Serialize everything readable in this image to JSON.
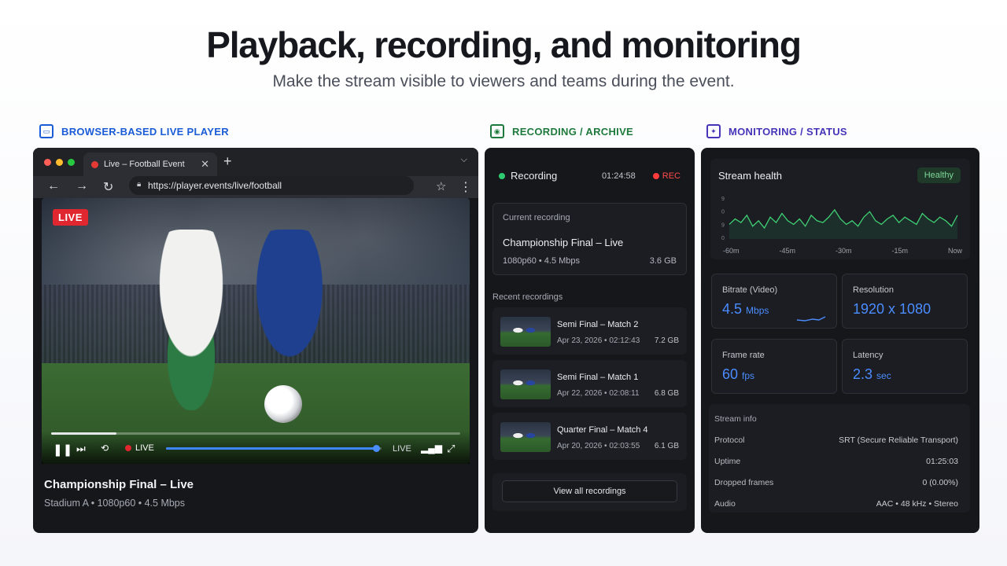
{
  "hero": {
    "title": "Playback, recording, and monitoring",
    "subtitle": "Make the stream visible to viewers and teams during the event."
  },
  "sections": {
    "player": "BROWSER-BASED LIVE PLAYER",
    "recording": "RECORDING / ARCHIVE",
    "monitoring": "MONITORING / STATUS"
  },
  "colors": {
    "blue": "#1a5bd6",
    "green": "#1d7a3c",
    "purple": "#4635b8",
    "live_red": "#e0262e",
    "accent": "#4b8cff"
  },
  "browser": {
    "tab_title": "Live – Football Event",
    "url": "https://player.events/live/football",
    "icons": [
      "back-arrow-icon",
      "forward-arrow-icon",
      "reload-icon",
      "lock-icon",
      "star-icon",
      "kebab-menu-icon",
      "close-icon",
      "plus-icon",
      "chevron-down-icon"
    ]
  },
  "player": {
    "live_badge": "LIVE",
    "controls_live": "LIVE",
    "controls_live_right": "LIVE",
    "progress": 0.99,
    "buffer": 0.16,
    "title": "Championship Final – Live",
    "meta": "Stadium A  •  1080p60  •  4.5 Mbps"
  },
  "recording": {
    "status": "Recording",
    "elapsed": "01:24:58",
    "rec_label": "REC",
    "current_label": "Current recording",
    "current_title": "Championship Final – Live",
    "current_meta": "1080p60  •  4.5 Mbps",
    "current_size": "3.6 GB",
    "recent_label": "Recent recordings",
    "items": [
      {
        "title": "Semi Final – Match 2",
        "meta": "Apr 23, 2026  •  02:12:43",
        "size": "7.2 GB"
      },
      {
        "title": "Semi Final – Match 1",
        "meta": "Apr 22, 2026  •  02:08:11",
        "size": "6.8 GB"
      },
      {
        "title": "Quarter Final – Match 4",
        "meta": "Apr 20, 2026  •  02:03:55",
        "size": "6.1 GB"
      }
    ],
    "view_all": "View all recordings"
  },
  "monitoring": {
    "health_title": "Stream health",
    "health_status": "Healthy",
    "chart": {
      "y_ticks": [
        "9",
        "0",
        "9",
        "0"
      ],
      "x_ticks": [
        "-60m",
        "-45m",
        "-30m",
        "-15m",
        "Now"
      ],
      "values": [
        5.8,
        6.1,
        5.9,
        6.3,
        5.7,
        6.0,
        5.6,
        6.2,
        5.9,
        6.4,
        6.0,
        5.8,
        6.1,
        5.7,
        6.3,
        6.0,
        5.9,
        6.2,
        6.6,
        6.1,
        5.8,
        6.0,
        5.7,
        6.2,
        6.5,
        6.0,
        5.8,
        6.1,
        6.3,
        5.9,
        6.2,
        6.0,
        5.8,
        6.4,
        6.1,
        5.9,
        6.2,
        6.0,
        5.7,
        6.3
      ]
    },
    "metrics": [
      {
        "label": "Bitrate (Video)",
        "value": "4.5",
        "unit": "Mbps"
      },
      {
        "label": "Resolution",
        "value": "1920 x 1080",
        "unit": ""
      },
      {
        "label": "Frame rate",
        "value": "60",
        "unit": "fps"
      },
      {
        "label": "Latency",
        "value": "2.3",
        "unit": "sec"
      }
    ],
    "info_title": "Stream info",
    "info": [
      {
        "k": "Protocol",
        "v": "SRT (Secure Reliable Transport)"
      },
      {
        "k": "Uptime",
        "v": "01:25:03"
      },
      {
        "k": "Dropped frames",
        "v": "0 (0.00%)"
      },
      {
        "k": "Audio",
        "v": "AAC  •  48 kHz  •  Stereo"
      }
    ]
  }
}
